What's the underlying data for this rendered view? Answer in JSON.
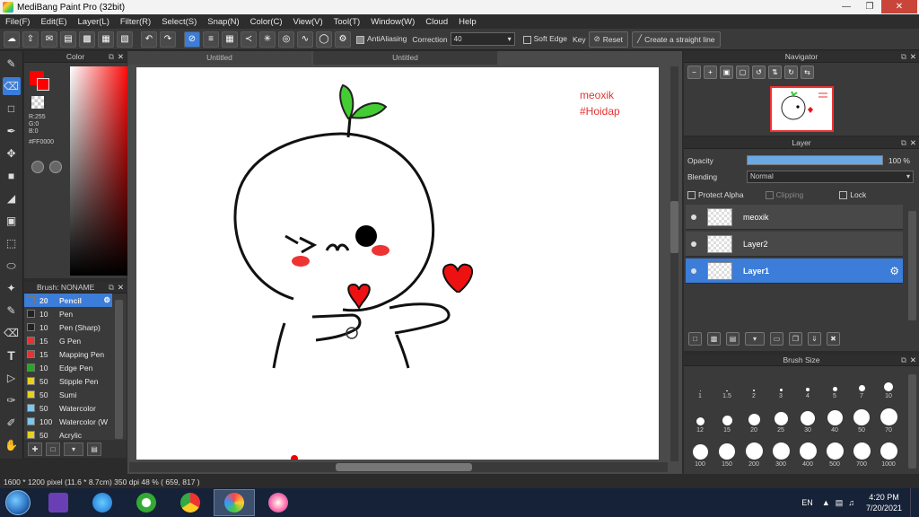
{
  "window": {
    "title": "MediBang Paint Pro (32bit)"
  },
  "menu": [
    "File(F)",
    "Edit(E)",
    "Layer(L)",
    "Filter(R)",
    "Select(S)",
    "Snap(N)",
    "Color(C)",
    "View(V)",
    "Tool(T)",
    "Window(W)",
    "Cloud",
    "Help"
  ],
  "toolbar": {
    "antialiasing_label": "AntiAliasing",
    "correction_label": "Correction",
    "correction_value": "40",
    "soft_edge_label": "Soft Edge",
    "key_label": "Key",
    "reset_label": "Reset",
    "straight_line_label": "Create a straight line"
  },
  "color_panel": {
    "title": "Color",
    "r": "R:255",
    "g": "G:0",
    "b": "B:0",
    "hex": "#FF0000",
    "foreground": "#ff0000"
  },
  "brush_panel": {
    "title": "Brush: NONAME",
    "brushes": [
      {
        "size": "20",
        "name": "Pencil",
        "color": "#3b7dd8",
        "selected": true
      },
      {
        "size": "10",
        "name": "Pen",
        "color": "#222222"
      },
      {
        "size": "10",
        "name": "Pen (Sharp)",
        "color": "#222222"
      },
      {
        "size": "15",
        "name": "G Pen",
        "color": "#e33333"
      },
      {
        "size": "15",
        "name": "Mapping Pen",
        "color": "#e33333"
      },
      {
        "size": "10",
        "name": "Edge Pen",
        "color": "#22aa22"
      },
      {
        "size": "50",
        "name": "Stipple Pen",
        "color": "#e8d020"
      },
      {
        "size": "50",
        "name": "Sumi",
        "color": "#e8d020"
      },
      {
        "size": "50",
        "name": "Watercolor",
        "color": "#7ac7f0"
      },
      {
        "size": "100",
        "name": "Watercolor (W",
        "color": "#7ac7f0"
      },
      {
        "size": "50",
        "name": "Acrylic",
        "color": "#e8d020"
      },
      {
        "size": "100",
        "name": "Airbrush",
        "color": "#ffffff"
      }
    ]
  },
  "documents": {
    "tabs": [
      "Untitled",
      "Untitled"
    ],
    "canvas_text": [
      "meoxik",
      "#Hoidap"
    ]
  },
  "status": "1600 * 1200 pixel   (11.6 * 8.7cm)   350 dpi   48 %   ( 659, 817 )",
  "navigator": {
    "title": "Navigator"
  },
  "layer_panel": {
    "title": "Layer",
    "opacity_label": "Opacity",
    "opacity_value": "100 %",
    "opacity_fraction": 1.0,
    "blending_label": "Blending",
    "blending_value": "Normal",
    "protect_alpha_label": "Protect Alpha",
    "clipping_label": "Clipping",
    "lock_label": "Lock",
    "layers": [
      {
        "name": "meoxik",
        "selected": false
      },
      {
        "name": "Layer2",
        "selected": false
      },
      {
        "name": "Layer1",
        "selected": true
      }
    ]
  },
  "brush_size": {
    "title": "Brush Size",
    "sizes": [
      "1",
      "1.5",
      "2",
      "3",
      "4",
      "5",
      "7",
      "10",
      "12",
      "15",
      "20",
      "25",
      "30",
      "40",
      "50",
      "70",
      "100",
      "150",
      "200",
      "300",
      "400",
      "500",
      "700",
      "1000"
    ]
  },
  "taskbar": {
    "language": "EN",
    "time": "4:20 PM",
    "date": "7/20/2021"
  }
}
